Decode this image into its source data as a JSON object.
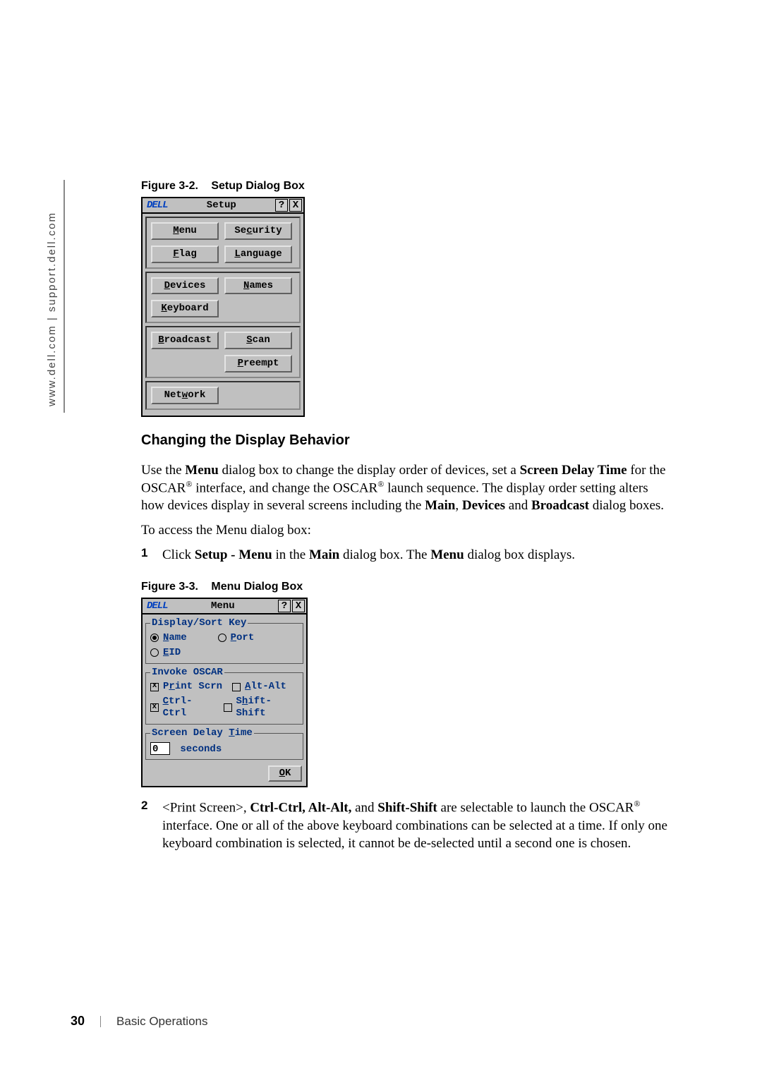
{
  "side_url": "www.dell.com | support.dell.com",
  "figure_32": {
    "label": "Figure 3-2.",
    "title": "Setup Dialog Box"
  },
  "figure_33": {
    "label": "Figure 3-3.",
    "title": "Menu Dialog Box"
  },
  "setup_dialog": {
    "logo": "DELL",
    "title": "Setup",
    "help_glyph": "?",
    "close_glyph": "X",
    "buttons": {
      "menu": {
        "pre": "",
        "ul": "M",
        "post": "enu"
      },
      "security": {
        "pre": "Se",
        "ul": "c",
        "post": "urity"
      },
      "flag": {
        "pre": "",
        "ul": "F",
        "post": "lag"
      },
      "language": {
        "pre": "",
        "ul": "L",
        "post": "anguage"
      },
      "devices": {
        "pre": "",
        "ul": "D",
        "post": "evices"
      },
      "names": {
        "pre": "",
        "ul": "N",
        "post": "ames"
      },
      "keyboard": {
        "pre": "",
        "ul": "K",
        "post": "eyboard"
      },
      "broadcast": {
        "pre": "",
        "ul": "B",
        "post": "roadcast"
      },
      "scan": {
        "pre": "",
        "ul": "S",
        "post": "can"
      },
      "preempt": {
        "pre": "",
        "ul": "P",
        "post": "reempt"
      },
      "network": {
        "pre": "Net",
        "ul": "w",
        "post": "ork"
      }
    }
  },
  "heading_changing": "Changing the Display Behavior",
  "paragraphs": {
    "p1_a": "Use the ",
    "p1_menu": "Menu",
    "p1_b": " dialog box to change the display order of devices, set a ",
    "p1_sdt": "Screen Delay Time",
    "p1_c": " for the OSCAR",
    "p1_reg": "®",
    "p1_d": " interface, and change the OSCAR",
    "p1_e": " launch sequence. The display order setting alters how devices display in several screens including the ",
    "p1_main": "Main",
    "p1_comma": ", ",
    "p1_devices": "Devices",
    "p1_and": " and ",
    "p1_broadcast": "Broadcast",
    "p1_f": " dialog boxes.",
    "p2": "To access the Menu dialog box:",
    "step1_a": "Click ",
    "step1_setup_menu": "Setup - Menu",
    "step1_b": " in the ",
    "step1_main": "Main",
    "step1_c": " dialog box. The ",
    "step1_menu": "Menu",
    "step1_d": " dialog box displays.",
    "step2_a": "<Print Screen>, ",
    "step2_cc": "Ctrl-Ctrl, Alt-Alt,",
    "step2_b": " and ",
    "step2_ss": "Shift-Shift",
    "step2_c": " are selectable to launch the OSCAR",
    "step2_reg": "®",
    "step2_d": " interface. One or all of the above keyboard combinations can be selected at a time. If only one keyboard combination is selected, it cannot be de-selected until a second one is chosen."
  },
  "menu_dialog": {
    "logo": "DELL",
    "title": "Menu",
    "help_glyph": "?",
    "close_glyph": "X",
    "group1_legend": "Display/Sort Key",
    "radio_name": {
      "ul": "N",
      "post": "ame",
      "selected": true
    },
    "radio_port": {
      "ul": "P",
      "post": "ort",
      "selected": false
    },
    "radio_eid": {
      "ul": "E",
      "post": "ID",
      "selected": false
    },
    "group2_legend": "Invoke OSCAR",
    "chk_print": {
      "pre": "P",
      "ul": "r",
      "post": "int Scrn",
      "selected": true
    },
    "chk_altalt": {
      "ul": "A",
      "post": "lt-Alt",
      "selected": false
    },
    "chk_ctrl": {
      "ul": "C",
      "post": "trl-Ctrl",
      "selected": true
    },
    "chk_shift": {
      "pre": "S",
      "ul": "h",
      "post": "ift-Shift",
      "selected": false
    },
    "group3_legend_pre": "Screen Delay ",
    "group3_legend_ul": "T",
    "group3_legend_post": "ime",
    "seconds_value": "0",
    "seconds_label": "seconds",
    "ok_ul": "O",
    "ok_post": "K"
  },
  "step_numbers": {
    "one": "1",
    "two": "2"
  },
  "footer": {
    "page": "30",
    "chapter": "Basic Operations"
  }
}
